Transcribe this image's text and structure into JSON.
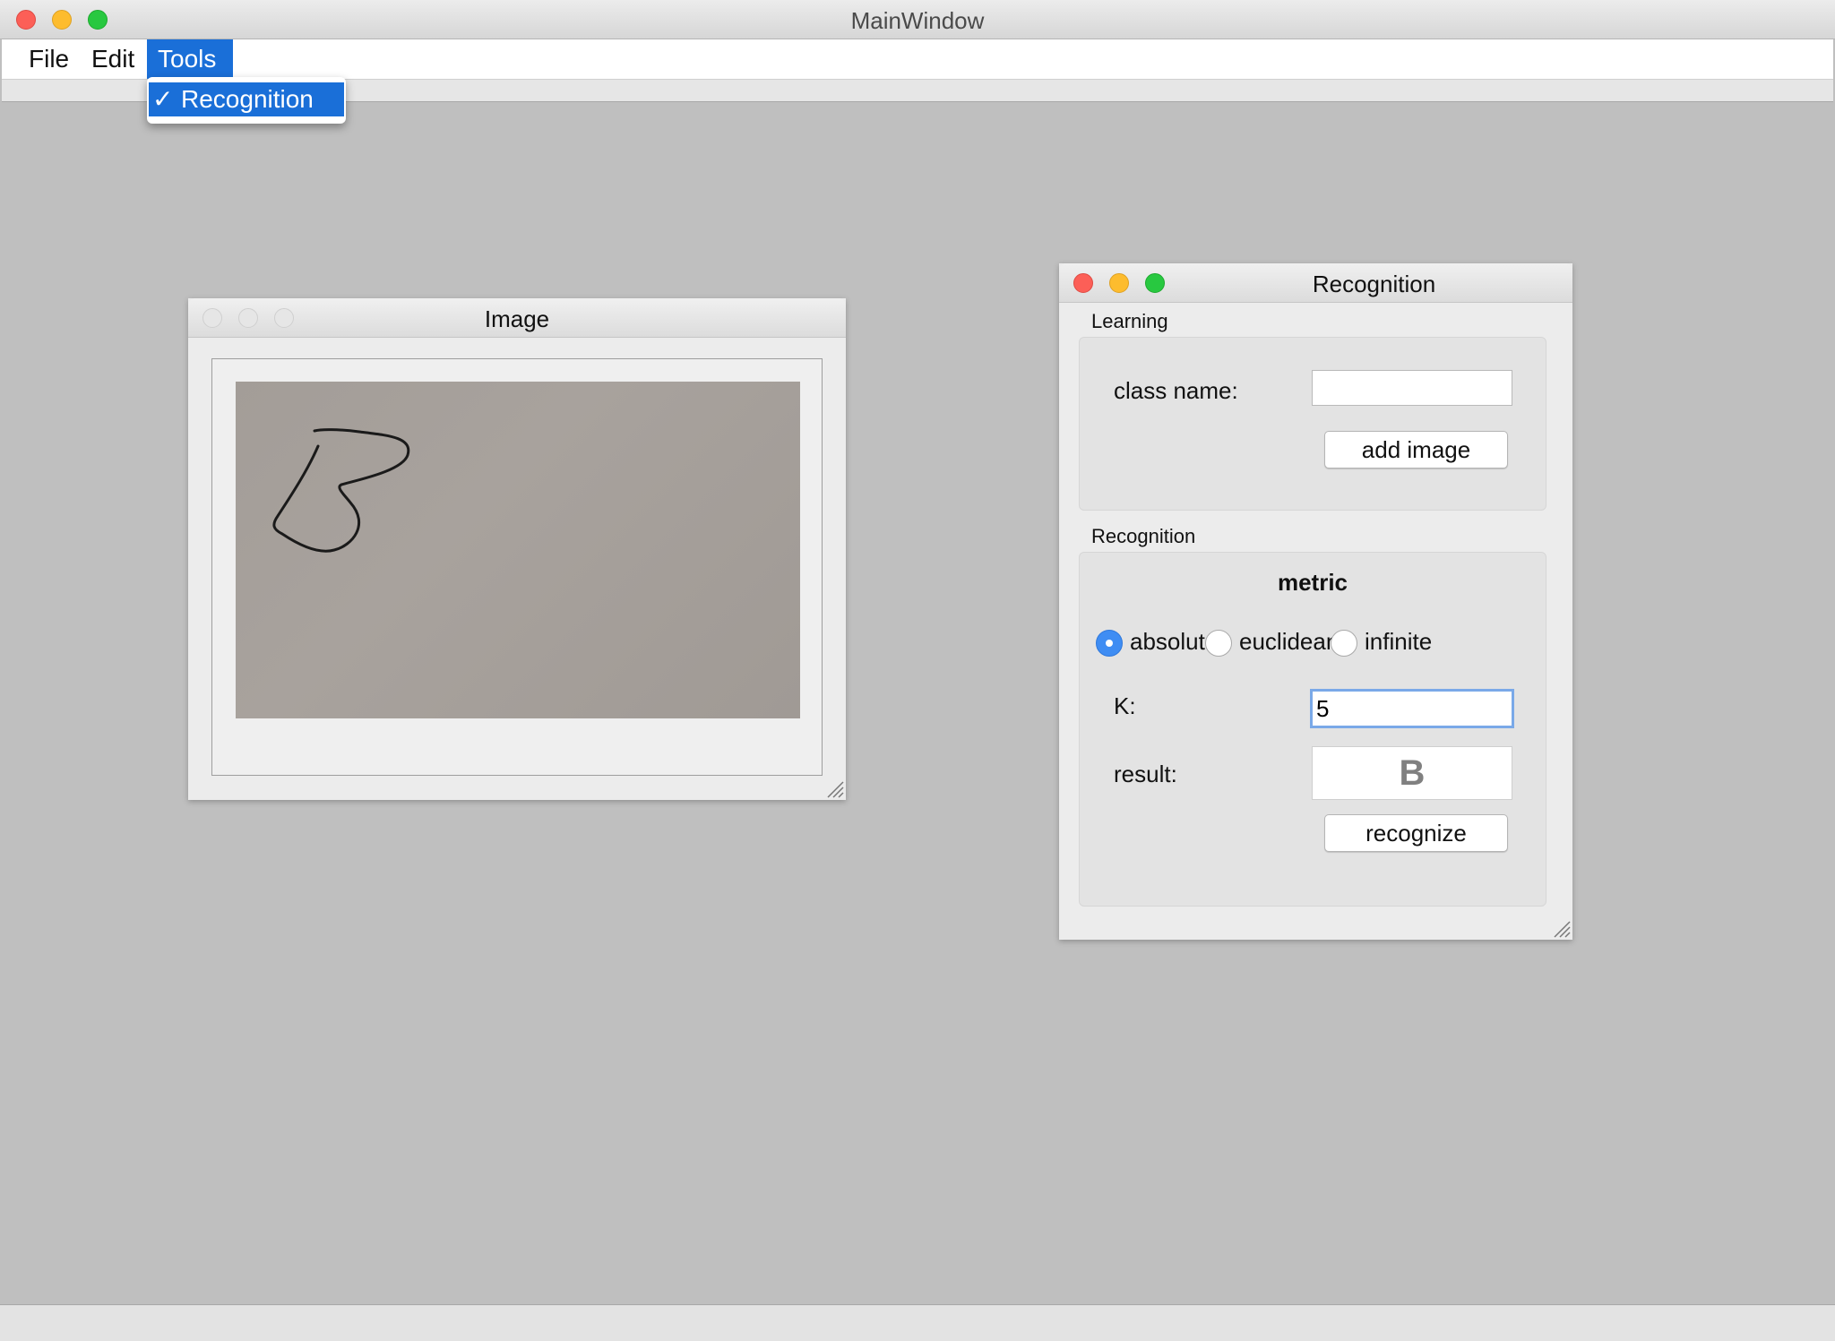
{
  "window": {
    "title": "MainWindow"
  },
  "menubar": {
    "file": "File",
    "edit": "Edit",
    "tools": "Tools"
  },
  "tools_menu": {
    "item_label": "Recognition",
    "checked": true,
    "check_glyph": "✓"
  },
  "image_window": {
    "title": "Image"
  },
  "recognition_window": {
    "title": "Recognition",
    "learning": {
      "group_label": "Learning",
      "class_name_label": "class name:",
      "class_name_value": "",
      "add_image_button": "add image"
    },
    "recognition": {
      "group_label": "Recognition",
      "metric_heading": "metric",
      "metrics": [
        {
          "label": "absolute",
          "checked": true
        },
        {
          "label": "euclidean",
          "checked": false
        },
        {
          "label": "infinite",
          "checked": false
        }
      ],
      "k_label": "K:",
      "k_value": "5",
      "result_label": "result:",
      "result_value": "B",
      "recognize_button": "recognize"
    }
  },
  "colors": {
    "accent": "#1a6fd8",
    "radio_selected": "#3f8df3",
    "background": "#bfbfbf"
  }
}
